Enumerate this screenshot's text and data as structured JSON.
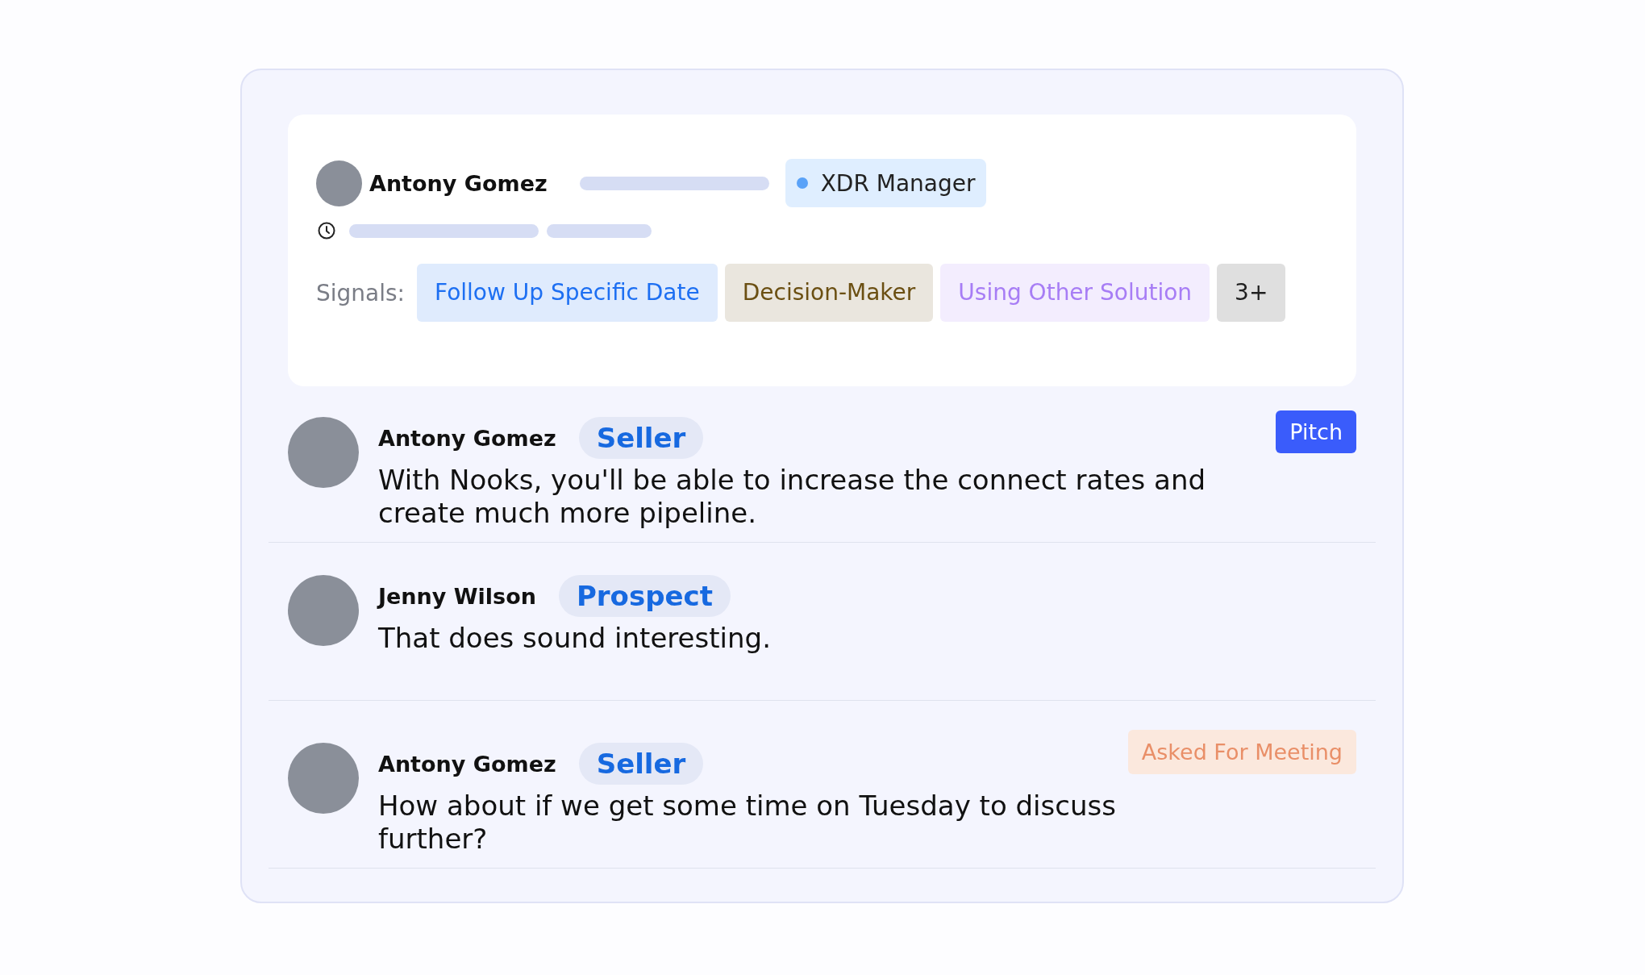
{
  "contact": {
    "name": "Antony Gomez",
    "role_tag": "XDR Manager"
  },
  "signals": {
    "label": "Signals:",
    "chips": [
      {
        "label": "Follow Up Specific Date",
        "color": "#1d6ff2"
      },
      {
        "label": "Decision-Maker",
        "color": "#6b4f12"
      },
      {
        "label": "Using Other Solution",
        "color": "#a77df5"
      },
      {
        "label": "3+",
        "color": "#1f1f1f"
      }
    ]
  },
  "messages": [
    {
      "speaker": "Antony Gomez",
      "role": "Seller",
      "text": "With Nooks, you'll be able to increase the connect rates and create much more pipeline.",
      "tag": {
        "label": "Pitch",
        "kind": "button"
      }
    },
    {
      "speaker": "Jenny Wilson",
      "role": "Prospect",
      "text": "That does sound interesting."
    },
    {
      "speaker": "Antony Gomez",
      "role": "Seller",
      "text": "How about if we get some time on Tuesday to discuss further?",
      "tag": {
        "label": "Asked For Meeting",
        "kind": "tag"
      }
    }
  ]
}
